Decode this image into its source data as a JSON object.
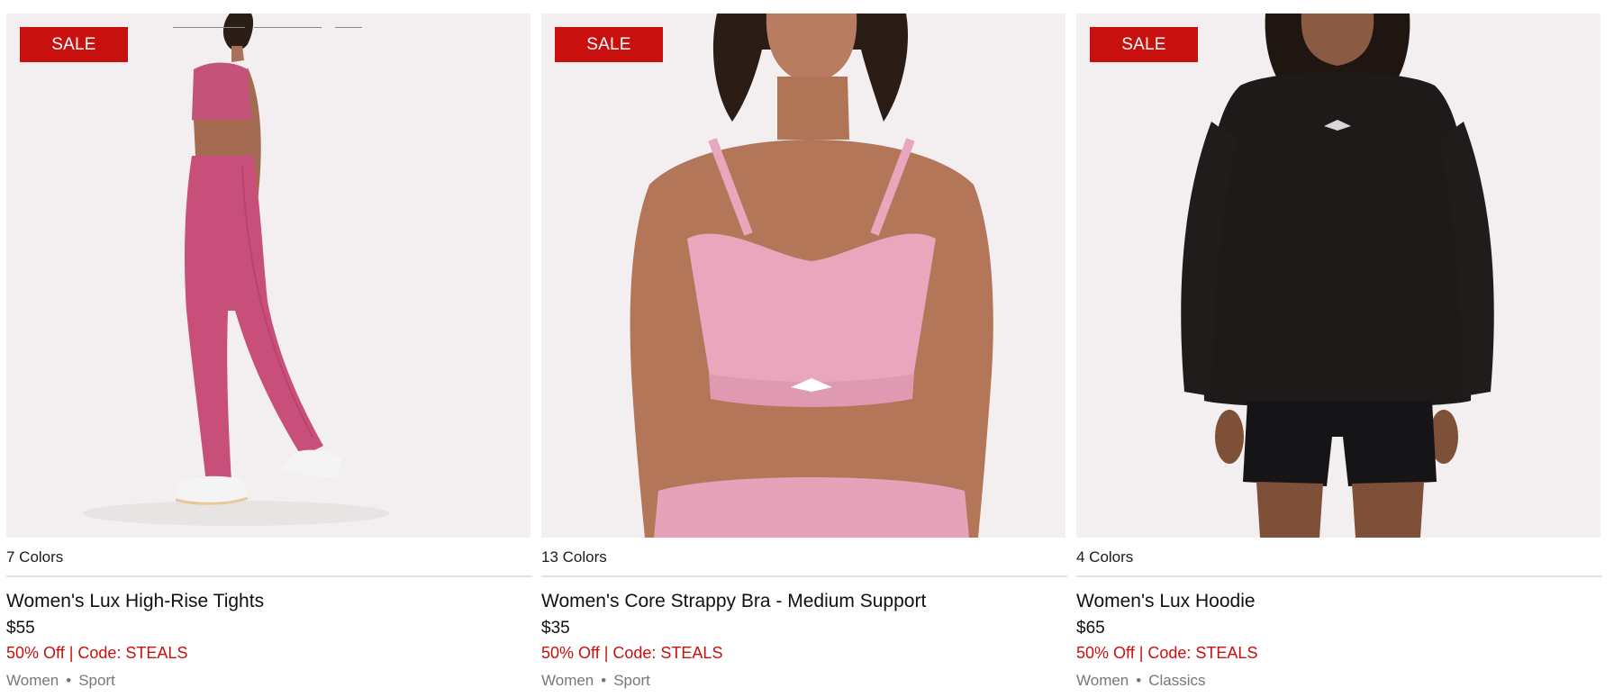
{
  "products": [
    {
      "badge": "SALE",
      "image_alt": "Women's Lux High-Rise Tights",
      "colors": "7 Colors",
      "name": "Women's Lux High-Rise Tights",
      "price": "$55",
      "promo": "50% Off | Code: STEALS",
      "gender": "Women",
      "separator": "•",
      "category": "Sport"
    },
    {
      "badge": "SALE",
      "image_alt": "Women's Core Strappy Bra - Medium Support",
      "colors": "13 Colors",
      "name": "Women's Core Strappy Bra - Medium Support",
      "price": "$35",
      "promo": "50% Off | Code: STEALS",
      "gender": "Women",
      "separator": "•",
      "category": "Sport"
    },
    {
      "badge": "SALE",
      "image_alt": "Women's Lux Hoodie",
      "colors": "4 Colors",
      "name": "Women's Lux Hoodie",
      "price": "$65",
      "promo": "50% Off | Code: STEALS",
      "gender": "Women",
      "separator": "•",
      "category": "Classics"
    }
  ],
  "colors": {
    "sale_red": "#c8100e",
    "image_bg": "#f3eff0",
    "meta_gray": "#777777",
    "divider": "#e2e2e2"
  }
}
